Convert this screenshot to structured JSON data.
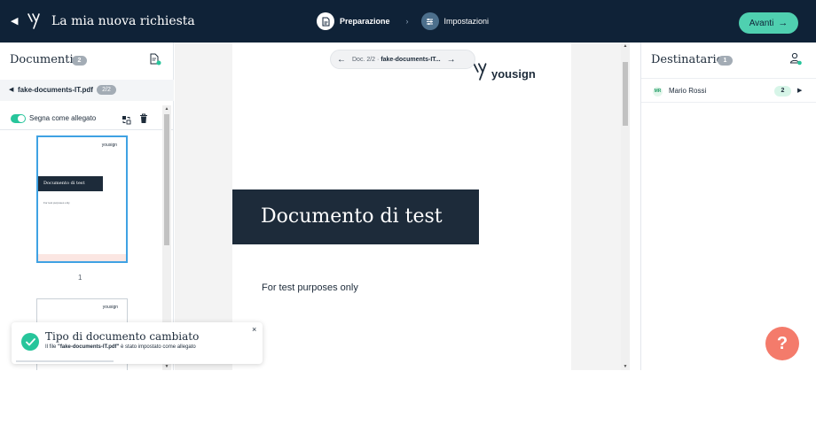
{
  "topbar": {
    "title": "La mia nuova richiesta",
    "steps": [
      {
        "label": "Preparazione",
        "active": true
      },
      {
        "label": "Impostazioni",
        "active": false
      }
    ],
    "next_label": "Avanti",
    "colors": {
      "bar": "#0f2237",
      "accent": "#4fd0b0"
    }
  },
  "left_panel": {
    "title": "Documenti",
    "count": "2",
    "file_name": "fake-documents-IT.pdf",
    "page_badge": "2/2",
    "attachment_label": "Segna come allegato",
    "attachment_enabled": true,
    "thumbnails": [
      {
        "logo": "yousign",
        "heading": "Documento di test",
        "sub": "For test purposes only",
        "page_label": "1"
      },
      {
        "logo": "yousign"
      }
    ]
  },
  "document": {
    "nav_text_prefix": "Doc. 2/2 ·",
    "nav_text_file": "fake-documents-IT...",
    "logo_word": "yousign",
    "heading": "Documento di test",
    "subtext": "For test purposes only"
  },
  "right_panel": {
    "title": "Destinatario",
    "count": "1",
    "signer": {
      "initials": "MR",
      "name": "Mario Rossi",
      "count": "2"
    }
  },
  "toast": {
    "title": "Tipo di documento cambiato",
    "msg_prefix": "Il file ",
    "msg_file": "\"fake-documents-IT.pdf\"",
    "msg_suffix": " è stato impostato come allegato",
    "close": "×"
  },
  "help": {
    "label": "?",
    "color": "#f47b6b"
  },
  "icons": [
    "back-icon",
    "yousign-logo-icon",
    "document-icon",
    "settings-sliders-icon",
    "arrow-right-icon",
    "add-document-icon",
    "replace-icon",
    "trash-icon",
    "add-signer-icon",
    "check-icon",
    "close-icon"
  ]
}
